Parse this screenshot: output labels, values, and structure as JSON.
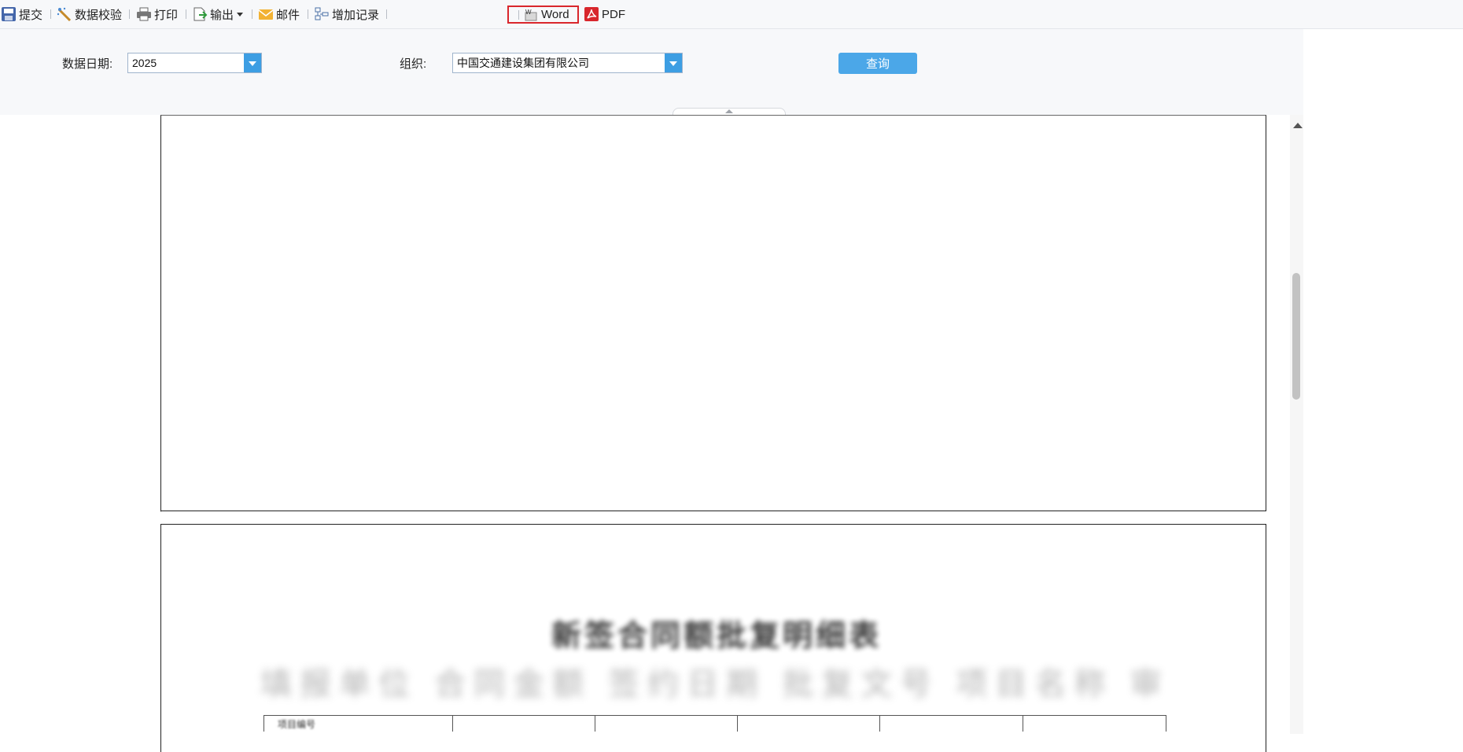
{
  "toolbar": {
    "submit": "提交",
    "validate": "数据校验",
    "print": "打印",
    "export": "输出",
    "mail": "邮件",
    "add_record": "增加记录",
    "word": "Word",
    "pdf": "PDF"
  },
  "query": {
    "date_label": "数据日期:",
    "date_value": "2025",
    "org_label": "组织:",
    "org_value": "中国交通建设集团有限公司",
    "search_button": "查询"
  },
  "document": {
    "title": "新签合同额批复明细表",
    "subtitle": "填报单位 合同金额 签约日期 批复文号 项目名称 审批状态",
    "first_cell": "项目编号"
  },
  "colors": {
    "accent": "#4ba7e8",
    "highlight_border": "#d9262c"
  }
}
